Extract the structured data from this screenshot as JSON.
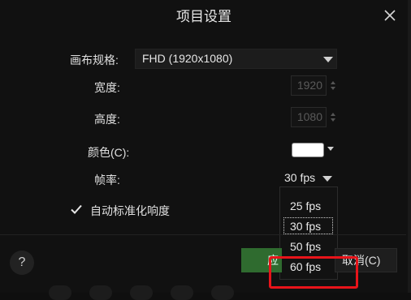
{
  "dialog": {
    "title": "项目设置"
  },
  "fields": {
    "canvas_label": "画布规格:",
    "canvas_value": "FHD (1920x1080)",
    "width_label": "宽度:",
    "width_value": "1920",
    "height_label": "高度:",
    "height_value": "1080",
    "color_label": "颜色(C):",
    "color_value": "#ffffff",
    "framerate_label": "帧率:",
    "framerate_value": "30 fps",
    "auto_normalize_label": "自动标准化响度",
    "auto_normalize_checked": true
  },
  "framerate_options": [
    "25 fps",
    "30 fps",
    "50 fps",
    "60 fps"
  ],
  "buttons": {
    "help": "?",
    "ok_partial": "应",
    "cancel": "取消(C)"
  },
  "icons": {
    "close": "close-icon",
    "dropdown": "triangle-down-icon",
    "check": "checkmark-icon"
  },
  "colors": {
    "accent_green": "#2f6b2f",
    "highlight_red": "#e8141a"
  }
}
